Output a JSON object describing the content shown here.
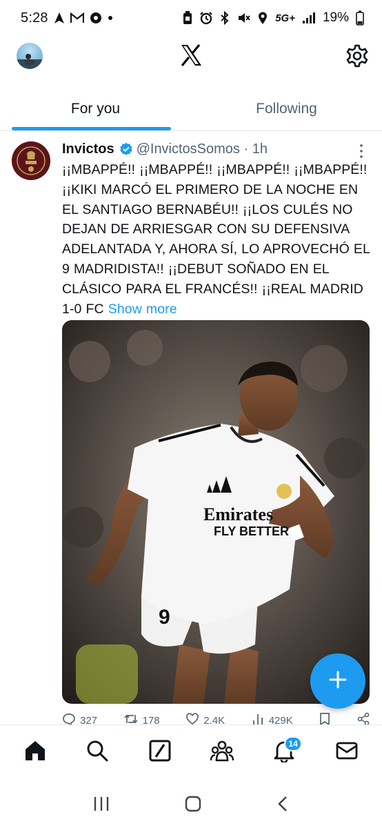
{
  "status_bar": {
    "time": "5:28",
    "network": "5G+",
    "battery": "19%"
  },
  "header": {
    "logo": "x-logo",
    "settings_icon": "gear-icon"
  },
  "tabs": [
    {
      "label": "For you",
      "active": true
    },
    {
      "label": "Following",
      "active": false
    }
  ],
  "tweet": {
    "author_name": "Invictos",
    "handle": "@InvictosSomos",
    "separator": " · ",
    "time": "1h",
    "text": "¡¡MBAPPÉ!! ¡¡MBAPPÉ!! ¡¡MBAPPÉ!! ¡¡MBAPPÉ!! ¡¡KIKI MARCÓ EL PRIMERO DE LA NOCHE EN EL SANTIAGO BERNABÉU!! ¡¡LOS CULÉS NO DEJAN DE ARRIESGAR CON SU DEFENSIVA ADELANTADA Y, AHORA SÍ, LO APROVECHÓ EL 9 MADRIDISTA!! ¡¡DEBUT SOÑADO EN EL CLÁSICO PARA EL FRANCÉS!! ¡¡REAL MADRID 1-0 FC ",
    "show_more": "Show more",
    "media": {
      "jersey_sponsor_line1": "Emirates",
      "jersey_sponsor_line2": "FLY BETTER",
      "shorts_number": "9"
    },
    "actions": {
      "replies": "327",
      "reposts": "178",
      "likes": "2.4K",
      "views": "429K"
    }
  },
  "fab": {
    "icon": "plus-icon"
  },
  "bottom_nav": {
    "notifications_badge": "14",
    "items": [
      "home-icon",
      "search-icon",
      "grok-icon",
      "communities-icon",
      "notifications-icon",
      "messages-icon"
    ]
  },
  "colors": {
    "accent": "#1d9bf0",
    "text_primary": "#0f1419",
    "text_secondary": "#536471"
  }
}
